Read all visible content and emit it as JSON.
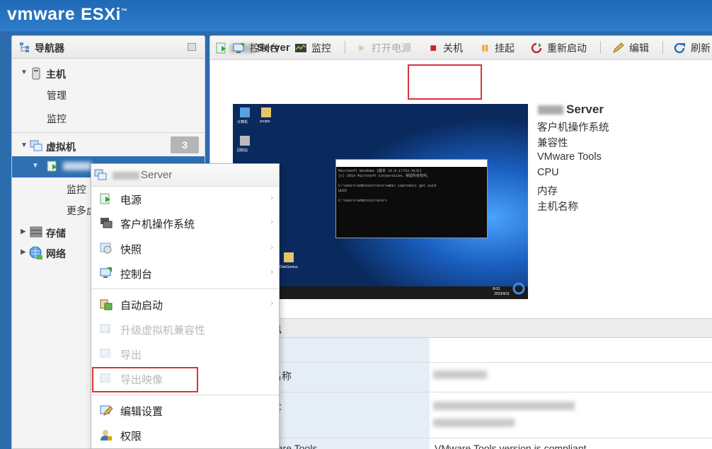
{
  "app": {
    "brand_vm": "vm",
    "brand_ware": "ware",
    "product": "ESXi",
    "tm": "™"
  },
  "navigator": {
    "title": "导航器",
    "host": {
      "label": "主机",
      "children": [
        "管理",
        "监控"
      ]
    },
    "vms": {
      "label": "虚拟机",
      "count": "3",
      "child_label": "",
      "child_items": [
        "监控",
        "更多虚"
      ]
    },
    "storage": {
      "label": "存储"
    },
    "network": {
      "label": "网络"
    }
  },
  "main": {
    "title": "Server",
    "toolbar": {
      "console": "控制台",
      "monitor": "监控",
      "power_on": "打开电源",
      "shutdown": "关机",
      "suspend": "挂起",
      "restart": "重新启动",
      "edit": "编辑",
      "refresh": "刷新"
    },
    "vm_name": "Server",
    "properties": [
      "客户机操作系统",
      "兼容性",
      "VMware Tools",
      "CPU",
      "内存",
      "主机名称"
    ],
    "general": {
      "header": "信息",
      "rows": [
        {
          "label": "络",
          "value": ""
        },
        {
          "label": "机名称",
          "value": ""
        },
        {
          "label": "地址",
          "value": ""
        },
        {
          "label": "Mware Tools",
          "value": "VMware Tools version is compliant"
        }
      ]
    }
  },
  "console_preview": {
    "desktop_icons": [
      "计算机",
      "scripts",
      "回收站",
      "DiskGenius"
    ],
    "cmd_lines": [
      "Microsoft Windows [版本 10.0.17763.4131]",
      "(c) 2018 Microsoft Corporation。保留所有权利。",
      "",
      "C:\\Users\\Administrator>wmic csproduct get uuid",
      "UUID",
      "",
      "C:\\Users\\Administrator>"
    ],
    "clock": "8:03",
    "date": "2023/4/11"
  },
  "context_menu": {
    "title": "Server",
    "items": [
      {
        "label": "电源",
        "submenu": true,
        "disabled": false
      },
      {
        "label": "客户机操作系统",
        "submenu": true,
        "disabled": false
      },
      {
        "label": "快照",
        "submenu": true,
        "disabled": false
      },
      {
        "label": "控制台",
        "submenu": true,
        "disabled": false
      },
      {
        "label": "自动启动",
        "submenu": true,
        "disabled": false
      },
      {
        "label": "升级虚拟机兼容性",
        "submenu": false,
        "disabled": true
      },
      {
        "label": "导出",
        "submenu": false,
        "disabled": true
      },
      {
        "label": "导出映像",
        "submenu": false,
        "disabled": true
      },
      {
        "label": "编辑设置",
        "submenu": false,
        "disabled": false
      },
      {
        "label": "权限",
        "submenu": false,
        "disabled": false
      }
    ],
    "submenu_arrow": "›"
  },
  "colors": {
    "header_blue": "#1f69b6",
    "highlight": "#d9333a",
    "selection": "#2e6fb2"
  }
}
